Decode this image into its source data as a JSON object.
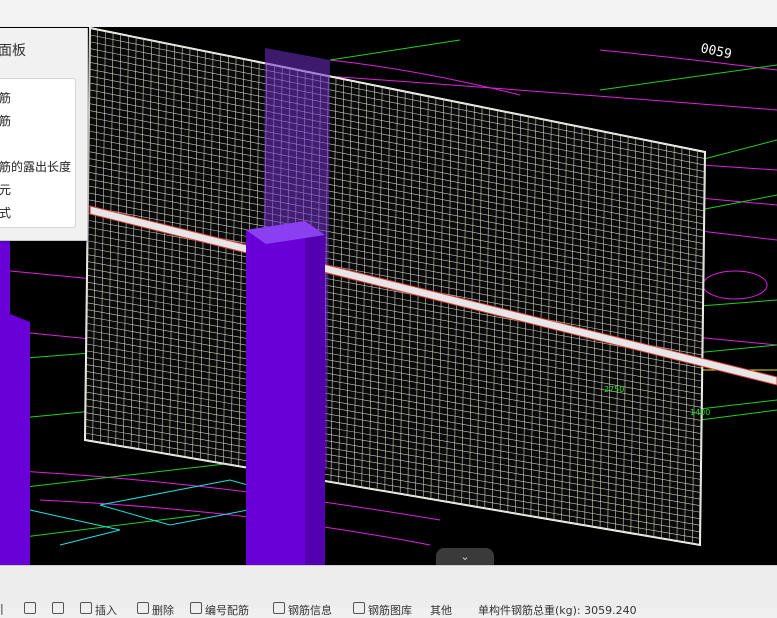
{
  "panel": {
    "title": "面板",
    "items": [
      "筋",
      "筋",
      "筋的露出长度",
      "元",
      "式"
    ]
  },
  "viewport": {
    "labels": [
      "0059",
      "2750",
      "1400"
    ],
    "colors": {
      "background": "#000000",
      "column": "#6a00d8",
      "mesh": "#d8d8c8",
      "contour": "#e020e0",
      "guide": "#20e020",
      "dim": "#e8e800",
      "wall_band": "#7030c8"
    }
  },
  "collapse_handle": {
    "icon": "chevron-down-icon",
    "glyph": "⌄"
  },
  "statusbar": {
    "tools": [
      {
        "label": "|",
        "icon": "separator"
      },
      {
        "label": "",
        "icon": "box-icon"
      },
      {
        "label": "",
        "icon": "box-icon"
      },
      {
        "label": "插入",
        "icon": "insert-icon"
      },
      {
        "label": "删除",
        "icon": "delete-icon"
      },
      {
        "label": "编号配筋",
        "icon": "rebar-icon"
      },
      {
        "label": "钢筋信息",
        "icon": "info-icon"
      },
      {
        "label": "钢筋图库",
        "icon": "library-icon"
      },
      {
        "label": "其他",
        "icon": "other-icon"
      },
      {
        "label": "单构件钢筋总重(kg): 3059.240",
        "icon": ""
      }
    ]
  }
}
